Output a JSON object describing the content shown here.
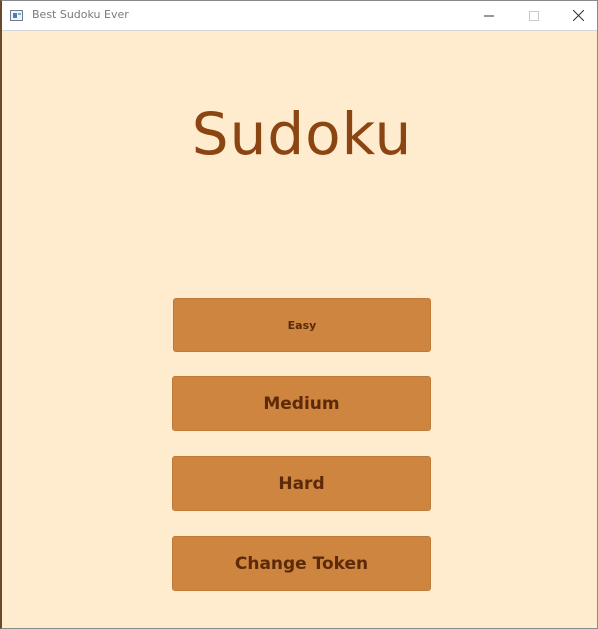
{
  "window": {
    "title": "Best Sudoku Ever",
    "controls": {
      "minimize": "minimize-icon",
      "maximize": "maximize-icon",
      "close": "close-icon"
    }
  },
  "main": {
    "heading": "Sudoku",
    "buttons": {
      "easy": "Easy",
      "medium": "Medium",
      "hard": "Hard",
      "change_token": "Change Token"
    }
  },
  "colors": {
    "background": "#ffebcd",
    "heading": "#8b4513",
    "button_fill": "#cd853f",
    "button_text": "#5c2a08"
  }
}
